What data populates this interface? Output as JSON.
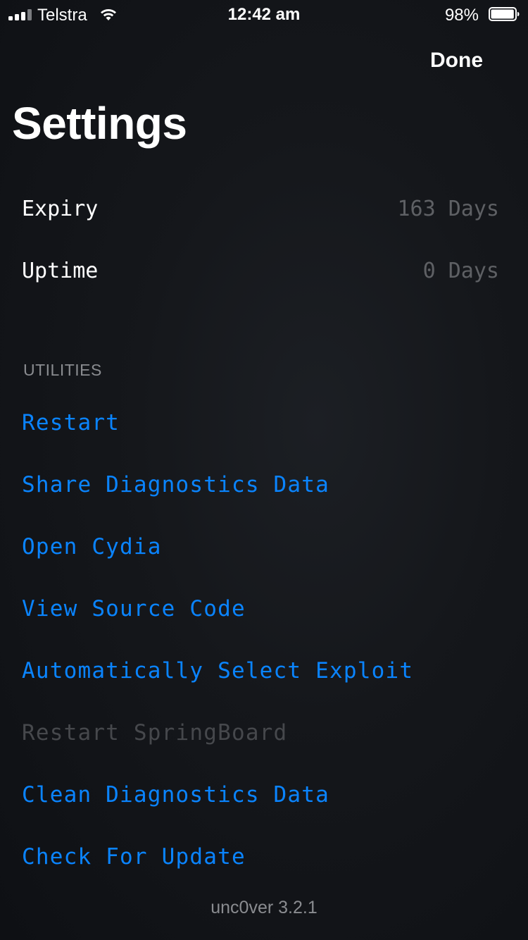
{
  "status_bar": {
    "carrier": "Telstra",
    "time": "12:42 am",
    "battery_percent": "98%",
    "signal_bars_active": 3,
    "signal_bars_total": 4,
    "battery_level": 0.98
  },
  "nav": {
    "done_label": "Done",
    "title": "Settings"
  },
  "info_rows": [
    {
      "label": "Expiry",
      "value": "163 Days"
    },
    {
      "label": "Uptime",
      "value": "0 Days"
    }
  ],
  "utilities": {
    "header": "UTILITIES",
    "items": [
      {
        "label": "Restart",
        "enabled": true
      },
      {
        "label": "Share Diagnostics Data",
        "enabled": true
      },
      {
        "label": "Open Cydia",
        "enabled": true
      },
      {
        "label": "View Source Code",
        "enabled": true
      },
      {
        "label": "Automatically Select Exploit",
        "enabled": true
      },
      {
        "label": "Restart SpringBoard",
        "enabled": false
      },
      {
        "label": "Clean Diagnostics Data",
        "enabled": true
      },
      {
        "label": "Check For Update",
        "enabled": true
      }
    ]
  },
  "footer": {
    "version": "unc0ver 3.2.1"
  },
  "colors": {
    "accent": "#0a84ff",
    "disabled": "#46484c",
    "secondary_text": "#5e6064",
    "background": "#15171b"
  }
}
